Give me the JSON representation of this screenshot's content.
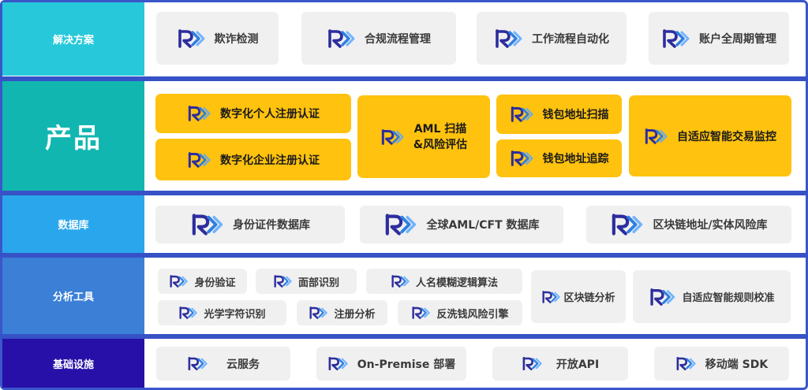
{
  "colors": {
    "solutions": "#27c8da",
    "products": "#12b6b0",
    "database": "#2aa7ec",
    "tools": "#3b7fd6",
    "infra": "#2710a8",
    "frame": "#3a56c9",
    "box_gray": "#f0f0f0",
    "box_yellow": "#ffc20e"
  },
  "icons": {
    "brand_logo": "r-chevron-logo-icon"
  },
  "rows": {
    "solutions": {
      "label": "解决方案",
      "items": [
        "欺诈检测",
        "合规流程管理",
        "工作流程自动化",
        "账户全周期管理"
      ]
    },
    "products": {
      "label": "产品",
      "items": [
        "数字化个人注册认证",
        "数字化企业注册认证",
        "AML 扫描\n&风险评估",
        "钱包地址扫描",
        "钱包地址追踪",
        "自适应智能交易监控"
      ]
    },
    "database": {
      "label": "数据库",
      "items": [
        "身份证件数据库",
        "全球AML/CFT 数据库",
        "区块链地址/实体风险库"
      ]
    },
    "tools": {
      "label": "分析工具",
      "items": [
        "身份验证",
        "面部识别",
        "人名模糊逻辑算法",
        "光学字符识别",
        "注册分析",
        "反洗钱风险引擎",
        "区块链分析",
        "自适应智能规则校准"
      ]
    },
    "infra": {
      "label": "基础设施",
      "items": [
        "云服务",
        "On-Premise 部署",
        "开放API",
        "移动端 SDK"
      ]
    }
  }
}
